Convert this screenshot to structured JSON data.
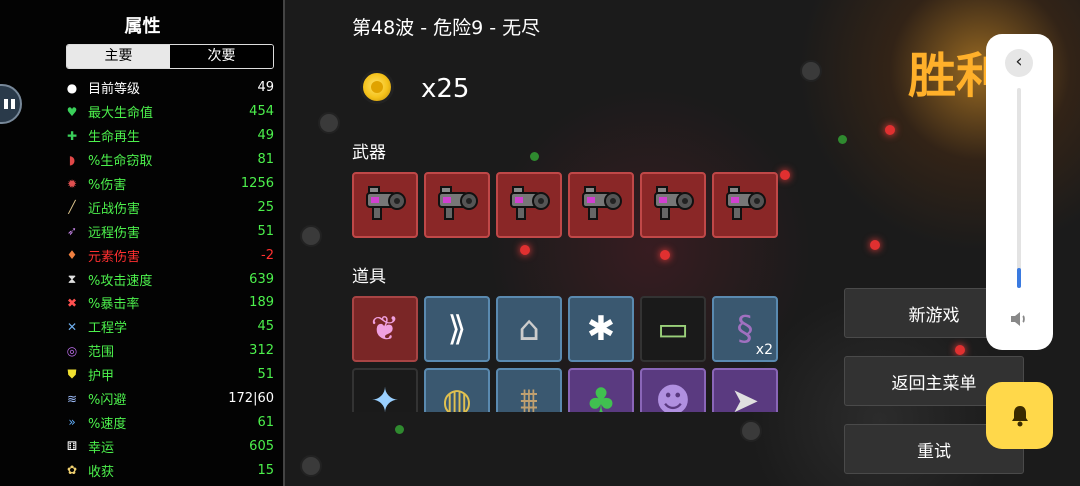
{
  "stats": {
    "title": "属性",
    "tabs": [
      {
        "label": "主要",
        "active": true
      },
      {
        "label": "次要",
        "active": false
      }
    ],
    "rows": [
      {
        "icon": "level-icon",
        "glyph": "●",
        "icon_color": "#ffffff",
        "name": "目前等级",
        "value": "49",
        "name_color": "#ffffff",
        "value_color": "#ffffff"
      },
      {
        "icon": "heart-icon",
        "glyph": "♥",
        "icon_color": "#3ad05a",
        "name": "最大生命值",
        "value": "454",
        "name_color": "#4cf04c",
        "value_color": "#4cf04c"
      },
      {
        "icon": "regen-icon",
        "glyph": "✚",
        "icon_color": "#3ad05a",
        "name": "生命再生",
        "value": "49",
        "name_color": "#4cf04c",
        "value_color": "#4cf04c"
      },
      {
        "icon": "lifesteal-icon",
        "glyph": "◗",
        "icon_color": "#e04848",
        "name": "%生命窃取",
        "value": "81",
        "name_color": "#4cf04c",
        "value_color": "#4cf04c"
      },
      {
        "icon": "damage-icon",
        "glyph": "✹",
        "icon_color": "#e05050",
        "name": "%伤害",
        "value": "1256",
        "name_color": "#4cf04c",
        "value_color": "#4cf04c"
      },
      {
        "icon": "melee-icon",
        "glyph": "╱",
        "icon_color": "#e0c890",
        "name": "近战伤害",
        "value": "25",
        "name_color": "#4cf04c",
        "value_color": "#4cf04c"
      },
      {
        "icon": "ranged-icon",
        "glyph": "➶",
        "icon_color": "#c080e0",
        "name": "远程伤害",
        "value": "51",
        "name_color": "#4cf04c",
        "value_color": "#4cf04c"
      },
      {
        "icon": "elemental-icon",
        "glyph": "♦",
        "icon_color": "#f08040",
        "name": "元素伤害",
        "value": "-2",
        "name_color": "#ff3030",
        "value_color": "#ff3030"
      },
      {
        "icon": "hourglass-icon",
        "glyph": "⧗",
        "icon_color": "#e0e0e0",
        "name": "%攻击速度",
        "value": "639",
        "name_color": "#4cf04c",
        "value_color": "#4cf04c"
      },
      {
        "icon": "crit-icon",
        "glyph": "✖",
        "icon_color": "#ff5050",
        "name": "%暴击率",
        "value": "189",
        "name_color": "#4cf04c",
        "value_color": "#4cf04c"
      },
      {
        "icon": "engineering-icon",
        "glyph": "✕",
        "icon_color": "#70b0f0",
        "name": "工程学",
        "value": "45",
        "name_color": "#4cf04c",
        "value_color": "#4cf04c"
      },
      {
        "icon": "range-icon",
        "glyph": "◎",
        "icon_color": "#c070f0",
        "name": "范围",
        "value": "312",
        "name_color": "#4cf04c",
        "value_color": "#4cf04c"
      },
      {
        "icon": "armor-icon",
        "glyph": "⛊",
        "icon_color": "#f0e030",
        "name": "护甲",
        "value": "51",
        "name_color": "#4cf04c",
        "value_color": "#4cf04c"
      },
      {
        "icon": "dodge-icon",
        "glyph": "≋",
        "icon_color": "#a0c0ff",
        "name": "%闪避",
        "value": "172|60",
        "name_color": "#4cf04c",
        "value_color": "#ffffff"
      },
      {
        "icon": "speed-icon",
        "glyph": "»",
        "icon_color": "#60b0ff",
        "name": "%速度",
        "value": "61",
        "name_color": "#4cf04c",
        "value_color": "#4cf04c"
      },
      {
        "icon": "luck-icon",
        "glyph": "⚅",
        "icon_color": "#ffffff",
        "name": "幸运",
        "value": "605",
        "name_color": "#4cf04c",
        "value_color": "#4cf04c"
      },
      {
        "icon": "harvest-icon",
        "glyph": "✿",
        "icon_color": "#f0d070",
        "name": "收获",
        "value": "15",
        "name_color": "#4cf04c",
        "value_color": "#4cf04c"
      }
    ]
  },
  "run": {
    "wave_title": "第48波 - 危险9 - 无尽",
    "coins": "x25",
    "weapons_label": "武器",
    "items_label": "道具"
  },
  "weapons": [
    {
      "icon": "blaster-gun-icon"
    },
    {
      "icon": "blaster-gun-icon"
    },
    {
      "icon": "blaster-gun-icon"
    },
    {
      "icon": "blaster-gun-icon"
    },
    {
      "icon": "blaster-gun-icon"
    },
    {
      "icon": "blaster-gun-icon"
    }
  ],
  "items_row1": [
    {
      "icon": "rainbow-leaf-icon",
      "tier": "red",
      "qty": ""
    },
    {
      "icon": "claw-icon",
      "tier": "blue",
      "qty": ""
    },
    {
      "icon": "bunker-icon",
      "tier": "blue",
      "qty": ""
    },
    {
      "icon": "rabbit-icon",
      "tier": "blue",
      "qty": ""
    },
    {
      "icon": "banknote-icon",
      "tier": "dark",
      "qty": ""
    },
    {
      "icon": "tentacle-icon",
      "tier": "blue",
      "qty": "x2"
    }
  ],
  "items_row2": [
    {
      "icon": "fairy-icon",
      "tier": "dark"
    },
    {
      "icon": "helmet-icon",
      "tier": "blue"
    },
    {
      "icon": "barricade-icon",
      "tier": "blue"
    },
    {
      "icon": "clover-icon",
      "tier": "purple"
    },
    {
      "icon": "ghost-icon",
      "tier": "purple"
    },
    {
      "icon": "bullet-icon",
      "tier": "purple"
    }
  ],
  "actions": {
    "victory_label": "胜利",
    "new_game": "新游戏",
    "main_menu": "返回主菜单",
    "retry": "重试"
  },
  "volume": {
    "level": 0.1
  },
  "colors": {
    "accent_gold": "#ffb02a",
    "weapon_slot": "#8a2727",
    "item_blue": "#3a5870",
    "item_purple": "#5a3a80",
    "stat_green": "#4cf04c",
    "stat_red": "#ff3030"
  }
}
